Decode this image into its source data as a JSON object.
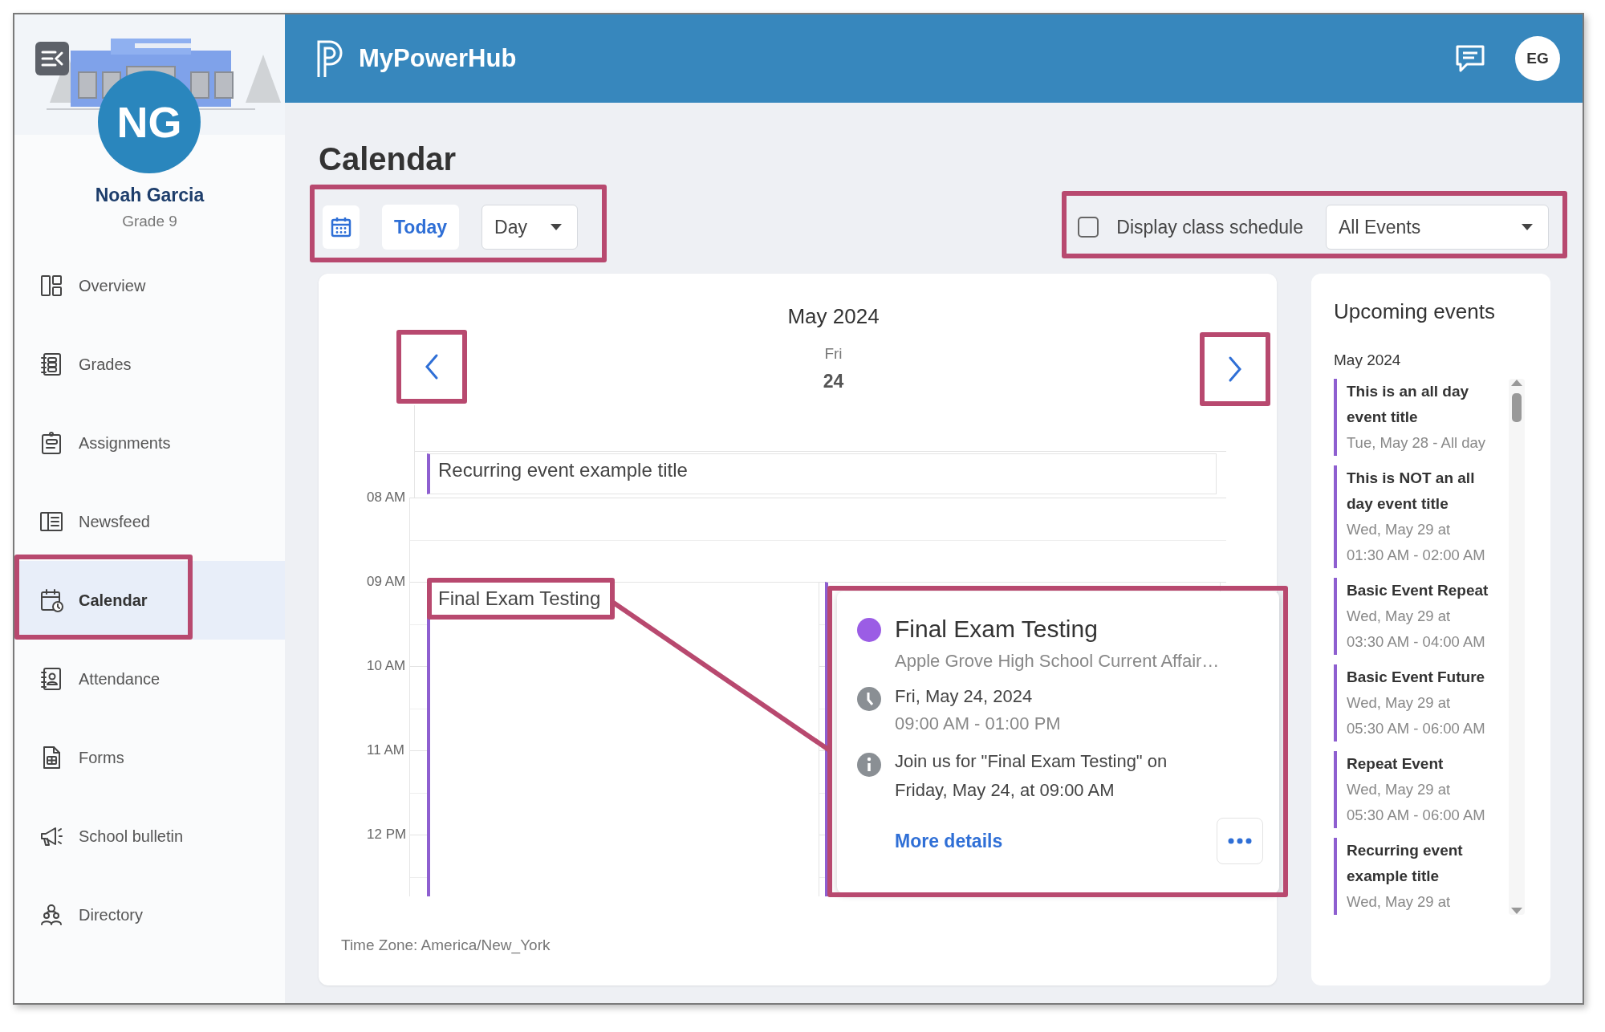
{
  "sidebar": {
    "profile": {
      "initials": "NG",
      "name": "Noah Garcia",
      "grade": "Grade 9"
    },
    "nav": [
      {
        "label": "Overview",
        "selected": false,
        "highlighted": false
      },
      {
        "label": "Grades",
        "selected": false,
        "highlighted": false
      },
      {
        "label": "Assignments",
        "selected": false,
        "highlighted": false
      },
      {
        "label": "Newsfeed",
        "selected": false,
        "highlighted": false
      },
      {
        "label": "Calendar",
        "selected": true,
        "highlighted": true
      },
      {
        "label": "Attendance",
        "selected": false,
        "highlighted": false
      },
      {
        "label": "Forms",
        "selected": false,
        "highlighted": false
      },
      {
        "label": "School bulletin",
        "selected": false,
        "highlighted": false
      },
      {
        "label": "Directory",
        "selected": false,
        "highlighted": false
      }
    ]
  },
  "header": {
    "brand": "MyPowerHub",
    "user_initials": "EG"
  },
  "page_title": "Calendar",
  "toolbar": {
    "highlighted": true,
    "today": "Today",
    "view": "Day"
  },
  "filters": {
    "highlighted": true,
    "class_schedule": {
      "label": "Display class schedule",
      "checked": false
    },
    "event_filter": "All Events"
  },
  "calendar": {
    "month": "May 2024",
    "weekday": "Fri",
    "day": "24",
    "prev_highlighted": true,
    "next_highlighted": true,
    "hours": [
      "08 AM",
      "09 AM",
      "10 AM",
      "11 AM",
      "12 PM"
    ],
    "events": [
      {
        "kind": "short",
        "title": "Recurring event example title",
        "highlighted": false
      },
      {
        "kind": "long",
        "title": "Final Exam Testing",
        "highlighted": true
      },
      {
        "kind": "covered"
      }
    ],
    "time_zone": "Time Zone: America/New_York"
  },
  "popup": {
    "highlighted": true,
    "title": "Final Exam Testing",
    "calendar_name": "Apple Grove High School Current Affair…",
    "date": "Fri, May 24, 2024",
    "time": "09:00 AM - 01:00 PM",
    "description": "Join us for \"Final Exam Testing\" on Friday, May 24, at 09:00 AM",
    "link": "More details"
  },
  "upcoming": {
    "title": "Upcoming events",
    "month": "May 2024",
    "events": [
      {
        "title": "This is an all day event title",
        "date": "Tue, May 28 - All day"
      },
      {
        "title": "This is NOT an all day event title",
        "date": "Wed, May 29 at",
        "time": "01:30 AM - 02:00 AM"
      },
      {
        "title": "Basic Event Repeat",
        "date": "Wed, May 29 at",
        "time": "03:30 AM - 04:00 AM"
      },
      {
        "title": "Basic Event Future",
        "date": "Wed, May 29 at",
        "time": "05:30 AM - 06:00 AM"
      },
      {
        "title": "Repeat Event",
        "date": "Wed, May 29 at",
        "time": "05:30 AM - 06:00 AM"
      },
      {
        "title": "Recurring event example title",
        "date": "Wed, May 29 at"
      }
    ]
  }
}
